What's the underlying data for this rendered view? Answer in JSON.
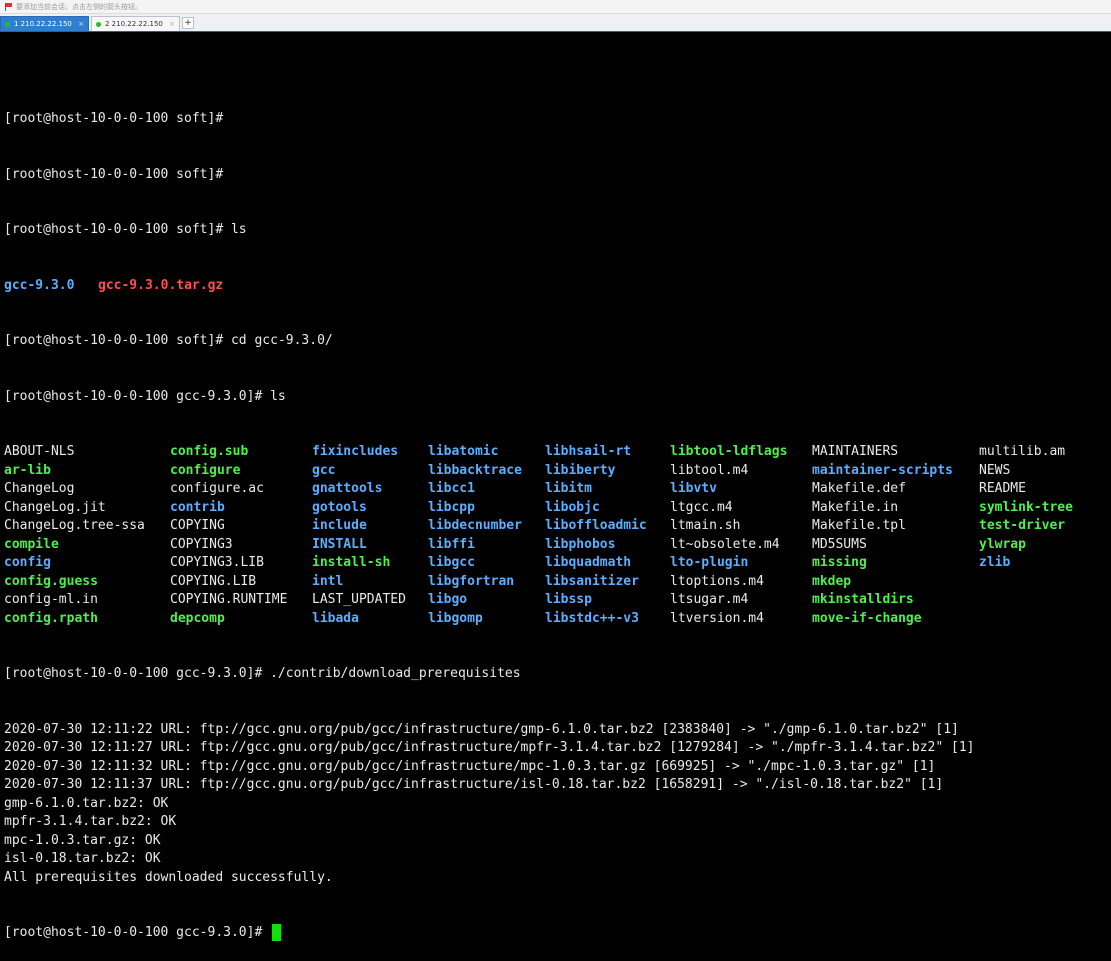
{
  "toolbar": {
    "hint": "要添加当前会话，点击左侧的箭头按钮。"
  },
  "tabs": [
    {
      "label": "1 210.22.22.150",
      "close": "×"
    },
    {
      "label": "2 210.22.22.150",
      "close": "×"
    }
  ],
  "new_tab_label": "+",
  "colors": {
    "directory": "#5aafff",
    "executable": "#4eef4e",
    "archive": "#ff5050",
    "cursor": "#10e010"
  },
  "terminal": {
    "prompt_soft": "[root@host-10-0-0-100 soft]# ",
    "prompt_gcc": "[root@host-10-0-0-100 gcc-9.3.0]# ",
    "cmd_ls": "ls",
    "cmd_cd": "cd gcc-9.3.0/",
    "cmd_download": "./contrib/download_prerequisites",
    "soft_listing": [
      {
        "name": "gcc-9.3.0",
        "type": "dir"
      },
      {
        "name": "gcc-9.3.0.tar.gz",
        "type": "arch"
      }
    ],
    "gcc_listing_columns": [
      [
        {
          "name": "ABOUT-NLS",
          "type": "file"
        },
        {
          "name": "ar-lib",
          "type": "exe"
        },
        {
          "name": "ChangeLog",
          "type": "file"
        },
        {
          "name": "ChangeLog.jit",
          "type": "file"
        },
        {
          "name": "ChangeLog.tree-ssa",
          "type": "file"
        },
        {
          "name": "compile",
          "type": "exe"
        },
        {
          "name": "config",
          "type": "dir"
        },
        {
          "name": "config.guess",
          "type": "exe"
        },
        {
          "name": "config-ml.in",
          "type": "file"
        },
        {
          "name": "config.rpath",
          "type": "exe"
        }
      ],
      [
        {
          "name": "config.sub",
          "type": "exe"
        },
        {
          "name": "configure",
          "type": "exe"
        },
        {
          "name": "configure.ac",
          "type": "file"
        },
        {
          "name": "contrib",
          "type": "dir"
        },
        {
          "name": "COPYING",
          "type": "file"
        },
        {
          "name": "COPYING3",
          "type": "file"
        },
        {
          "name": "COPYING3.LIB",
          "type": "file"
        },
        {
          "name": "COPYING.LIB",
          "type": "file"
        },
        {
          "name": "COPYING.RUNTIME",
          "type": "file"
        },
        {
          "name": "depcomp",
          "type": "exe"
        }
      ],
      [
        {
          "name": "fixincludes",
          "type": "dir"
        },
        {
          "name": "gcc",
          "type": "dir"
        },
        {
          "name": "gnattools",
          "type": "dir"
        },
        {
          "name": "gotools",
          "type": "dir"
        },
        {
          "name": "include",
          "type": "dir"
        },
        {
          "name": "INSTALL",
          "type": "dir"
        },
        {
          "name": "install-sh",
          "type": "exe"
        },
        {
          "name": "intl",
          "type": "dir"
        },
        {
          "name": "LAST_UPDATED",
          "type": "file"
        },
        {
          "name": "libada",
          "type": "dir"
        }
      ],
      [
        {
          "name": "libatomic",
          "type": "dir"
        },
        {
          "name": "libbacktrace",
          "type": "dir"
        },
        {
          "name": "libcc1",
          "type": "dir"
        },
        {
          "name": "libcpp",
          "type": "dir"
        },
        {
          "name": "libdecnumber",
          "type": "dir"
        },
        {
          "name": "libffi",
          "type": "dir"
        },
        {
          "name": "libgcc",
          "type": "dir"
        },
        {
          "name": "libgfortran",
          "type": "dir"
        },
        {
          "name": "libgo",
          "type": "dir"
        },
        {
          "name": "libgomp",
          "type": "dir"
        }
      ],
      [
        {
          "name": "libhsail-rt",
          "type": "dir"
        },
        {
          "name": "libiberty",
          "type": "dir"
        },
        {
          "name": "libitm",
          "type": "dir"
        },
        {
          "name": "libobjc",
          "type": "dir"
        },
        {
          "name": "liboffloadmic",
          "type": "dir"
        },
        {
          "name": "libphobos",
          "type": "dir"
        },
        {
          "name": "libquadmath",
          "type": "dir"
        },
        {
          "name": "libsanitizer",
          "type": "dir"
        },
        {
          "name": "libssp",
          "type": "dir"
        },
        {
          "name": "libstdc++-v3",
          "type": "dir"
        }
      ],
      [
        {
          "name": "libtool-ldflags",
          "type": "exe"
        },
        {
          "name": "libtool.m4",
          "type": "file"
        },
        {
          "name": "libvtv",
          "type": "dir"
        },
        {
          "name": "ltgcc.m4",
          "type": "file"
        },
        {
          "name": "ltmain.sh",
          "type": "file"
        },
        {
          "name": "lt~obsolete.m4",
          "type": "file"
        },
        {
          "name": "lto-plugin",
          "type": "dir"
        },
        {
          "name": "ltoptions.m4",
          "type": "file"
        },
        {
          "name": "ltsugar.m4",
          "type": "file"
        },
        {
          "name": "ltversion.m4",
          "type": "file"
        }
      ],
      [
        {
          "name": "MAINTAINERS",
          "type": "file"
        },
        {
          "name": "maintainer-scripts",
          "type": "dir"
        },
        {
          "name": "Makefile.def",
          "type": "file"
        },
        {
          "name": "Makefile.in",
          "type": "file"
        },
        {
          "name": "Makefile.tpl",
          "type": "file"
        },
        {
          "name": "MD5SUMS",
          "type": "file"
        },
        {
          "name": "missing",
          "type": "exe"
        },
        {
          "name": "mkdep",
          "type": "exe"
        },
        {
          "name": "mkinstalldirs",
          "type": "exe"
        },
        {
          "name": "move-if-change",
          "type": "exe"
        }
      ],
      [
        {
          "name": "multilib.am",
          "type": "file"
        },
        {
          "name": "NEWS",
          "type": "file"
        },
        {
          "name": "README",
          "type": "file"
        },
        {
          "name": "symlink-tree",
          "type": "exe"
        },
        {
          "name": "test-driver",
          "type": "exe"
        },
        {
          "name": "ylwrap",
          "type": "exe"
        },
        {
          "name": "zlib",
          "type": "dir"
        }
      ]
    ],
    "download_output": [
      "2020-07-30 12:11:22 URL: ftp://gcc.gnu.org/pub/gcc/infrastructure/gmp-6.1.0.tar.bz2 [2383840] -> \"./gmp-6.1.0.tar.bz2\" [1]",
      "2020-07-30 12:11:27 URL: ftp://gcc.gnu.org/pub/gcc/infrastructure/mpfr-3.1.4.tar.bz2 [1279284] -> \"./mpfr-3.1.4.tar.bz2\" [1]",
      "2020-07-30 12:11:32 URL: ftp://gcc.gnu.org/pub/gcc/infrastructure/mpc-1.0.3.tar.gz [669925] -> \"./mpc-1.0.3.tar.gz\" [1]",
      "2020-07-30 12:11:37 URL: ftp://gcc.gnu.org/pub/gcc/infrastructure/isl-0.18.tar.bz2 [1658291] -> \"./isl-0.18.tar.bz2\" [1]",
      "gmp-6.1.0.tar.bz2: OK",
      "mpfr-3.1.4.tar.bz2: OK",
      "mpc-1.0.3.tar.gz: OK",
      "isl-0.18.tar.bz2: OK",
      "All prerequisites downloaded successfully."
    ]
  }
}
